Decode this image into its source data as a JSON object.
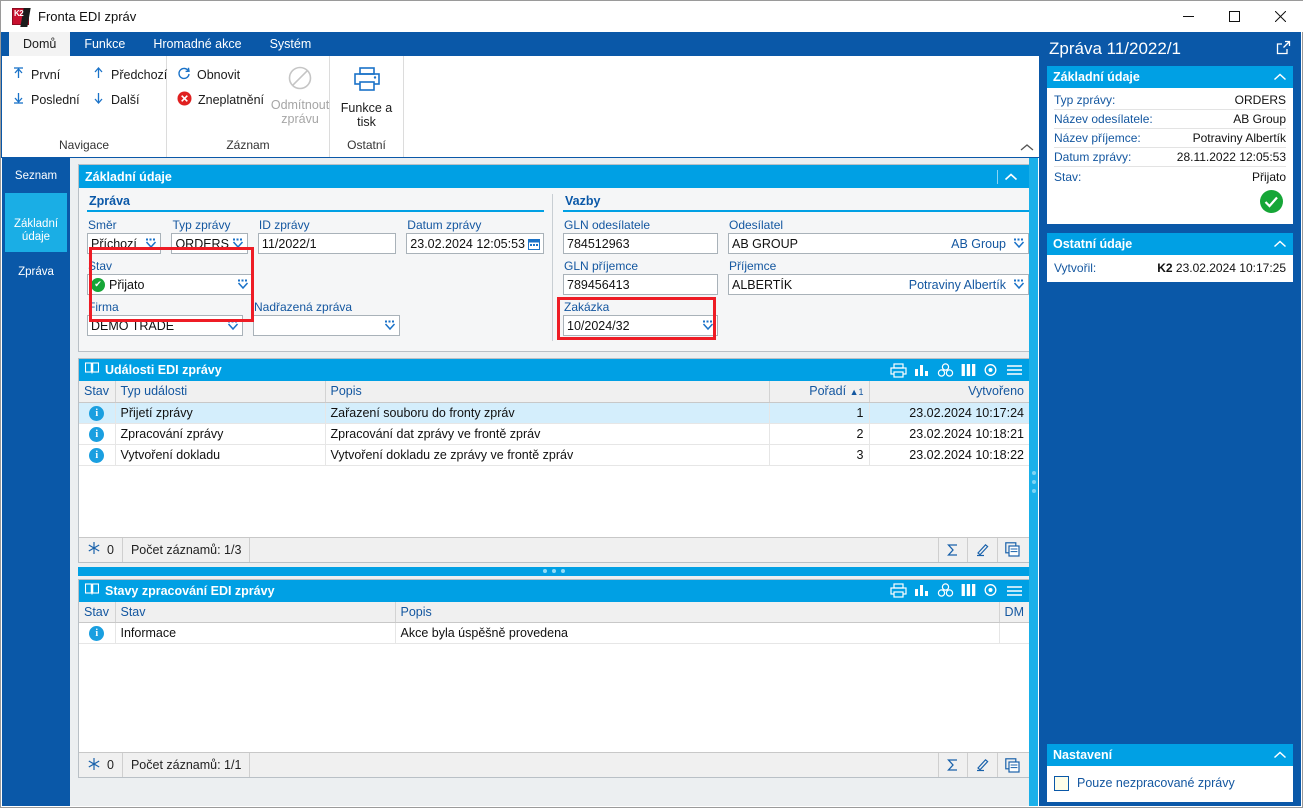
{
  "window": {
    "title": "Fronta EDI zpráv",
    "logo": "k2-logo",
    "minimize": "—",
    "maximize": "▢",
    "close": "✕"
  },
  "ribbon": {
    "tabs": [
      {
        "label": "Domů",
        "active": true
      },
      {
        "label": "Funkce",
        "active": false
      },
      {
        "label": "Hromadné akce",
        "active": false
      },
      {
        "label": "Systém",
        "active": false
      }
    ],
    "groups": [
      {
        "title": "Navigace",
        "items": [
          {
            "label": "První",
            "icon": "first-arrow-icon"
          },
          {
            "label": "Poslední",
            "icon": "last-arrow-icon"
          },
          {
            "label": "Předchozí",
            "icon": "up-arrow-icon"
          },
          {
            "label": "Další",
            "icon": "down-arrow-icon"
          }
        ]
      },
      {
        "title": "Záznam",
        "items": [
          {
            "label": "Obnovit",
            "icon": "refresh-icon"
          },
          {
            "label": "Zneplatnění",
            "icon": "invalidate-icon"
          },
          {
            "label": "Odmítnout zprávu",
            "icon": "reject-icon",
            "disabled": true
          }
        ]
      },
      {
        "title": "Ostatní",
        "items": [
          {
            "label": "Funkce a tisk",
            "icon": "printer-icon"
          }
        ]
      }
    ]
  },
  "sidebar": {
    "items": [
      {
        "label": "Seznam",
        "icon": "list-lines-icon",
        "active": false
      },
      {
        "label": "Základní údaje",
        "icon": "bulleted-list-icon",
        "active": true
      },
      {
        "label": "Zpráva",
        "icon": "list-lines-icon",
        "active": false
      }
    ]
  },
  "main": {
    "basic_panel": {
      "title": "Základní údaje",
      "collapse_icon": "chevron-up-icon",
      "message_section": {
        "title": "Zpráva",
        "fields": {
          "smer": {
            "label": "Směr",
            "value": "Příchozí"
          },
          "typ_zpravy": {
            "label": "Typ zprávy",
            "value": "ORDERS"
          },
          "id_zpravy": {
            "label": "ID zprávy",
            "value": "11/2022/1"
          },
          "datum_zpravy": {
            "label": "Datum zprávy",
            "value": "23.02.2024 12:05:53"
          },
          "stav": {
            "label": "Stav",
            "value": "Přijato"
          },
          "firma": {
            "label": "Firma",
            "value": "DEMO TRADE"
          },
          "nadrazena_zprava": {
            "label": "Nadřazená zpráva",
            "value": ""
          }
        }
      },
      "relations_section": {
        "title": "Vazby",
        "fields": {
          "gln_odesilatele": {
            "label": "GLN odesílatele",
            "value": "784512963"
          },
          "odesilatel": {
            "label": "Odesílatel",
            "value": "AB GROUP",
            "right_value": "AB Group"
          },
          "gln_prijemce": {
            "label": "GLN příjemce",
            "value": "789456413"
          },
          "prijemce": {
            "label": "Příjemce",
            "value": "ALBERTÍK",
            "right_value": "Potraviny Albertík"
          },
          "zakazka": {
            "label": "Zakázka",
            "value": "10/2024/32"
          }
        }
      }
    },
    "events_grid": {
      "title": "Události EDI zprávy",
      "book_icon": "book-icon",
      "toolbar_icons": [
        "printer-icon",
        "chart-icon",
        "group-icon",
        "columns-icon",
        "settings-icon",
        "menu-icon"
      ],
      "columns": [
        "Stav",
        "Typ události",
        "Popis",
        "Pořadí",
        "Vytvořeno"
      ],
      "sort_column": "Pořadí",
      "sort_indicator": "▲",
      "sort_order": "1",
      "rows": [
        {
          "stav": "info",
          "typ": "Přijetí zprávy",
          "popis": "Zařazení souboru do fronty zpráv",
          "poradi": "1",
          "vytvoreno": "23.02.2024 10:17:24",
          "selected": true
        },
        {
          "stav": "info",
          "typ": "Zpracování zprávy",
          "popis": "Zpracování dat zprávy ve frontě zpráv",
          "poradi": "2",
          "vytvoreno": "23.02.2024 10:18:21",
          "selected": false
        },
        {
          "stav": "info",
          "typ": "Vytvoření dokladu",
          "popis": "Vytvoření dokladu ze zprávy ve frontě zpráv",
          "poradi": "3",
          "vytvoreno": "23.02.2024 10:18:22",
          "selected": false
        }
      ],
      "footer": {
        "filter_icon": "filter-snowflake-icon",
        "filter_count": "0",
        "record_count": "Počet záznamů: 1/3",
        "icons": [
          "sum-icon",
          "edit-pencil-icon",
          "duplicate-icon"
        ]
      }
    },
    "states_grid": {
      "title": "Stavy zpracování EDI zprávy",
      "book_icon": "book-icon",
      "toolbar_icons": [
        "printer-icon",
        "chart-icon",
        "group-icon",
        "columns-icon",
        "settings-icon",
        "menu-icon"
      ],
      "columns": [
        "Stav",
        "Stav",
        "Popis",
        "DM"
      ],
      "rows": [
        {
          "stav": "info",
          "stav_text": "Informace",
          "popis": "Akce byla úspěšně provedena",
          "dm": ""
        }
      ],
      "footer": {
        "filter_icon": "filter-snowflake-icon",
        "filter_count": "0",
        "record_count": "Počet záznamů: 1/1",
        "icons": [
          "sum-icon",
          "edit-pencil-icon",
          "duplicate-icon"
        ]
      }
    }
  },
  "detail_panel": {
    "title": "Zpráva 11/2022/1",
    "popout_icon": "external-link-icon",
    "sections": [
      {
        "title": "Základní údaje",
        "collapse_icon": "chevron-up-icon",
        "rows": [
          {
            "key": "Typ zprávy:",
            "value": "ORDERS"
          },
          {
            "key": "Název odesílatele:",
            "value": "AB Group"
          },
          {
            "key": "Název příjemce:",
            "value": "Potraviny Albertík"
          },
          {
            "key": "Datum zprávy:",
            "value": "28.11.2022 12:05:53"
          },
          {
            "key": "Stav:",
            "value": "Přijato"
          }
        ],
        "status_icon": "green-check-icon"
      },
      {
        "title": "Ostatní údaje",
        "collapse_icon": "chevron-up-icon",
        "rows": [
          {
            "key": "Vytvořil:",
            "value_prefix": "K2",
            "value": "23.02.2024 10:17:25"
          }
        ]
      }
    ],
    "settings": {
      "title": "Nastavení",
      "collapse_icon": "chevron-up-icon",
      "checkbox_label": "Pouze nezpracované zprávy",
      "checkbox_checked": false
    }
  },
  "colors": {
    "ribbon_blue": "#0a58a8",
    "accent_cyan": "#00a0e4",
    "highlight_red": "#ee1c25",
    "success_green": "#16a637",
    "selected_row": "#d4eefc"
  }
}
